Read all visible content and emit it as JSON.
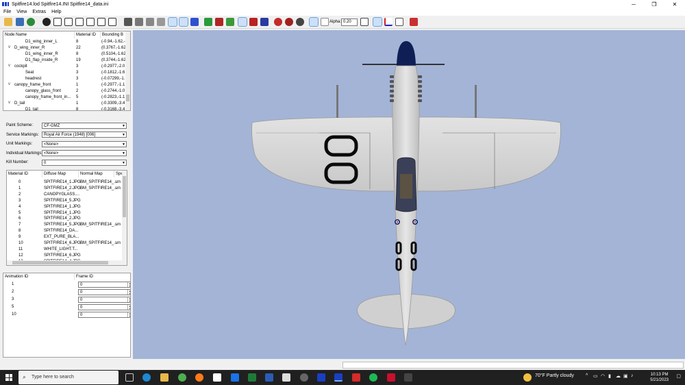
{
  "window": {
    "title": "Spitfire14.lod  Spitfire14.INI  Spitfire14_data.ini",
    "minimize_glyph": "─",
    "maximize_glyph": "❐",
    "close_glyph": "✕"
  },
  "menu": [
    "File",
    "View",
    "Extras",
    "Help"
  ],
  "toolbar": {
    "alpha_label": "Alpha:",
    "alpha_value": "0.20"
  },
  "tree": {
    "headers": [
      "Node Name",
      "Material ID",
      "Bounding B"
    ],
    "rows": [
      {
        "name": "D1_wing_inner_L",
        "mat": "8",
        "bb": "(-0.94,-1.62,-",
        "indent": 3,
        "expander": ""
      },
      {
        "name": "D_wing_inner_R",
        "mat": "22",
        "bb": "(0.3767,-1.62",
        "indent": 2,
        "expander": "v"
      },
      {
        "name": "D1_wing_inner_R",
        "mat": "8",
        "bb": "(0.5104,-1.62",
        "indent": 3,
        "expander": ""
      },
      {
        "name": "D1_flap_inside_R",
        "mat": "19",
        "bb": "(0.3744,-1.62",
        "indent": 3,
        "expander": ""
      },
      {
        "name": "cockpit",
        "mat": "3",
        "bb": "(-0.2977,-2.0",
        "indent": 2,
        "expander": "v"
      },
      {
        "name": "Seat",
        "mat": "3",
        "bb": "(-0.1812,-1.6",
        "indent": 3,
        "expander": ""
      },
      {
        "name": "headrest",
        "mat": "3",
        "bb": "(-0.07299,-1.",
        "indent": 3,
        "expander": ""
      },
      {
        "name": "canopy_frame_front",
        "mat": "1",
        "bb": "(-0.2977,-1.1",
        "indent": 2,
        "expander": "v"
      },
      {
        "name": "canopy_glass_front",
        "mat": "2",
        "bb": "(-0.2744,-1.0",
        "indent": 3,
        "expander": ""
      },
      {
        "name": "canopy_frame_front_in...",
        "mat": "5",
        "bb": "(-0.2823,-1.1",
        "indent": 3,
        "expander": ""
      },
      {
        "name": "D_tail",
        "mat": "1",
        "bb": "(-0.3309,-3.4",
        "indent": 2,
        "expander": "v"
      },
      {
        "name": "D1_tail",
        "mat": "8",
        "bb": "(-0.3168,-3.4",
        "indent": 3,
        "expander": ""
      }
    ]
  },
  "markings": {
    "fields": [
      {
        "label": "Paint Scheme:",
        "value": "CF-GMZ"
      },
      {
        "label": "Service Markings:",
        "value": "Royal Air Force (1948) [006]"
      },
      {
        "label": "Unit Markings:",
        "value": "<None>"
      },
      {
        "label": "Individual Markings:",
        "value": "<None>"
      },
      {
        "label": "Kill Number:",
        "value": "0"
      }
    ]
  },
  "materials": {
    "headers": [
      "Material ID",
      "Diffuse Map",
      "Normal Map",
      "Spe"
    ],
    "rows": [
      {
        "id": "0",
        "diffuse": "SPITFIRE14_1.JPG",
        "normal": "BM_SPITFIRE14_...",
        "spec": "sm"
      },
      {
        "id": "1",
        "diffuse": "SPITFIRE14_2.JPG",
        "normal": "BM_SPITFIRE14_...",
        "spec": "sm"
      },
      {
        "id": "2",
        "diffuse": "CANOPYGLASS....",
        "normal": "",
        "spec": ""
      },
      {
        "id": "3",
        "diffuse": "SPITFIRE14_5.JPG",
        "normal": "",
        "spec": ""
      },
      {
        "id": "4",
        "diffuse": "SPITFIRE14_1.JPG",
        "normal": "",
        "spec": ""
      },
      {
        "id": "5",
        "diffuse": "SPITFIRE14_1.JPG",
        "normal": "",
        "spec": ""
      },
      {
        "id": "6",
        "diffuse": "SPITFIRE14_2.JPG",
        "normal": "",
        "spec": ""
      },
      {
        "id": "7",
        "diffuse": "SPITFIRE14_5.JPG",
        "normal": "BM_SPITFIRE14_...",
        "spec": "sm"
      },
      {
        "id": "8",
        "diffuse": "SPITFIRE14_DA...",
        "normal": "",
        "spec": ""
      },
      {
        "id": "9",
        "diffuse": "EXT_PURE_BLA...",
        "normal": "",
        "spec": ""
      },
      {
        "id": "10",
        "diffuse": "SPITFIRE14_6.JPG",
        "normal": "BM_SPITFIRE14_...",
        "spec": "sm"
      },
      {
        "id": "11",
        "diffuse": "WHITE_LIGHT.T...",
        "normal": "",
        "spec": ""
      },
      {
        "id": "12",
        "diffuse": "SPITFIRE14_6.JPG",
        "normal": "",
        "spec": ""
      },
      {
        "id": "13",
        "diffuse": "SPITFIRE14_4.JPG",
        "normal": "",
        "spec": ""
      }
    ]
  },
  "animation": {
    "headers": [
      "Animation ID",
      "Frame ID"
    ],
    "rows": [
      {
        "id": "1",
        "frame": "0"
      },
      {
        "id": "2",
        "frame": "0"
      },
      {
        "id": "3",
        "frame": "0"
      },
      {
        "id": "5",
        "frame": "0"
      },
      {
        "id": "10",
        "frame": "0"
      }
    ]
  },
  "colors": {
    "viewport_bg": "#a3b4d7",
    "aircraft_body": "#d8d8d8",
    "marking_black": "#0a0a0a",
    "spinner_navy": "#0f1f55",
    "taskbar_bg": "#202020"
  },
  "taskbar": {
    "search_placeholder": "Type here to search",
    "weather": "70°F  Partly cloudy",
    "time": "10:13 PM",
    "date": "5/21/2023",
    "apps": [
      "task-view",
      "edge",
      "file-explorer",
      "chrome",
      "firefox",
      "notion",
      "mail",
      "excel",
      "word",
      "todo",
      "obs",
      "lod-viewer",
      "acrobat",
      "spotify",
      "mcafee",
      "other"
    ]
  }
}
